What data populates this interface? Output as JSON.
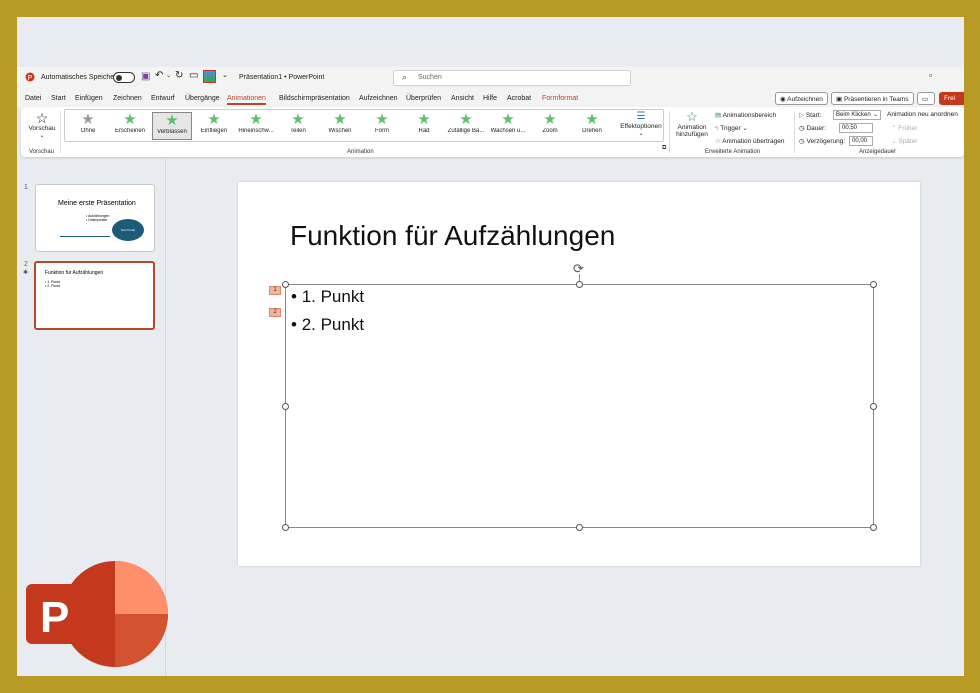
{
  "titlebar": {
    "autosave_label": "Automatisches Speichern",
    "doc_title": "Präsentation1 • PowerPoint",
    "search_placeholder": "Suchen"
  },
  "menu": {
    "tabs": [
      "Datei",
      "Start",
      "Einfügen",
      "Zeichnen",
      "Entwurf",
      "Übergänge",
      "Animationen",
      "Bildschirmpräsentation",
      "Aufzeichnen",
      "Überprüfen",
      "Ansicht",
      "Hilfe",
      "Acrobat",
      "Formformat"
    ],
    "active_tab": "Animationen",
    "right_buttons": {
      "record": "Aufzeichnen",
      "present_teams": "Präsentieren in Teams",
      "share": "Frei"
    }
  },
  "ribbon": {
    "preview": {
      "label": "Vorschau",
      "group": "Vorschau"
    },
    "animation_group": "Animation",
    "effects": [
      {
        "label": "Ohne",
        "icon": "star-gray-icon"
      },
      {
        "label": "Erscheinen",
        "icon": "star-green-icon"
      },
      {
        "label": "Verblassen",
        "icon": "star-green-icon",
        "selected": true
      },
      {
        "label": "Einfliegen",
        "icon": "star-green-icon"
      },
      {
        "label": "Hineinschw...",
        "icon": "star-green-icon"
      },
      {
        "label": "Teilen",
        "icon": "star-green-icon"
      },
      {
        "label": "Wischen",
        "icon": "star-green-icon"
      },
      {
        "label": "Form",
        "icon": "star-green-icon"
      },
      {
        "label": "Rad",
        "icon": "star-green-icon"
      },
      {
        "label": "Zufällige Ba...",
        "icon": "star-green-icon"
      },
      {
        "label": "Wachsen u...",
        "icon": "star-green-icon"
      },
      {
        "label": "Zoom",
        "icon": "star-green-icon"
      },
      {
        "label": "Drehen",
        "icon": "star-green-icon"
      }
    ],
    "effect_options": "Effektoptionen",
    "advanced": {
      "add_animation_line1": "Animation",
      "add_animation_line2": "hinzufügen",
      "pane": "Animationsbereich",
      "trigger": "Trigger",
      "painter": "Animation übertragen",
      "group": "Erweiterte Animation"
    },
    "timing": {
      "start_label": "Start:",
      "start_value": "Beim Klicken",
      "duration_label": "Dauer:",
      "duration_value": "00,50",
      "delay_label": "Verzögerung:",
      "delay_value": "00,00",
      "reorder": "Animation neu anordnen",
      "earlier": "Früher",
      "later": "Später",
      "group": "Anzeigedauer"
    }
  },
  "slides_panel": [
    {
      "number": "1",
      "title": "Meine erste Präsentation",
      "bullets": [
        "Aufzählungen",
        "Unterpunkte"
      ],
      "shape_text": "Text Punkt"
    },
    {
      "number": "2",
      "title": "Funktion für Aufzählungen",
      "bullets": [
        "1. Punkt",
        "2. Punkt"
      ]
    }
  ],
  "slide": {
    "title": "Funktion für Aufzählungen",
    "bullets": [
      "1. Punkt",
      "2. Punkt"
    ],
    "anim_tags": [
      "1",
      "2"
    ]
  },
  "colors": {
    "accent": "#b7472a",
    "frame": "#b89a24",
    "logo_dark": "#c4391d",
    "logo_light": "#ff8f6b"
  }
}
